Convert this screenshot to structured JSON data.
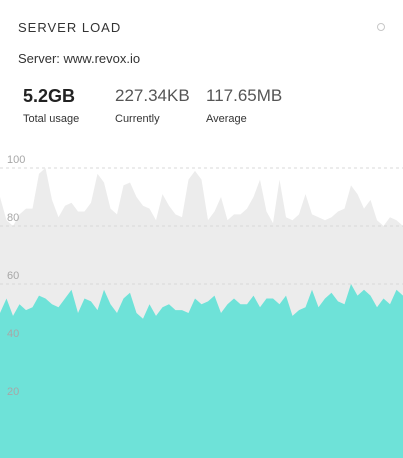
{
  "widget": {
    "title": "SERVER LOAD",
    "server_label": "Server: www.revox.io",
    "options_icon": "circle-options-icon"
  },
  "stats": [
    {
      "value": "5.2GB",
      "label": "Total usage"
    },
    {
      "value": "227.34KB",
      "label": "Currently"
    },
    {
      "value": "117.65MB",
      "label": "Average"
    }
  ],
  "colors": {
    "upper_area": "#ececec",
    "lower_area": "#6ee2d8",
    "grid": "#d9d9d9",
    "tick_text": "#a7a7a7"
  },
  "chart_data": {
    "type": "area",
    "title": "",
    "xlabel": "",
    "ylabel": "",
    "ylim": [
      0,
      100
    ],
    "yticks": [
      20,
      40,
      60,
      80,
      100
    ],
    "grid": "dashed horizontal",
    "series": [
      {
        "values": [
          90,
          82,
          80,
          84,
          86,
          86,
          98,
          100,
          89,
          83,
          87,
          88,
          85,
          85,
          88,
          98,
          95,
          86,
          84,
          94,
          95,
          90,
          87,
          86,
          82,
          91,
          87,
          84,
          83,
          96,
          99,
          96,
          82,
          85,
          90,
          82,
          84,
          84,
          86,
          90,
          96,
          85,
          81,
          96,
          83,
          82,
          84,
          91,
          84,
          83,
          82,
          83,
          85,
          86,
          94,
          91,
          86,
          89,
          82,
          80,
          83,
          82,
          80
        ]
      },
      {
        "values": [
          50,
          55,
          49,
          53,
          51,
          52,
          56,
          55,
          53,
          52,
          55,
          58,
          50,
          55,
          54,
          51,
          58,
          53,
          50,
          55,
          57,
          50,
          48,
          53,
          49,
          52,
          53,
          51,
          51,
          50,
          55,
          53,
          54,
          56,
          50,
          53,
          55,
          53,
          53,
          56,
          52,
          55,
          55,
          53,
          56,
          49,
          51,
          52,
          58,
          52,
          55,
          57,
          54,
          53,
          60,
          56,
          58,
          56,
          52,
          55,
          53,
          58,
          56
        ]
      }
    ]
  }
}
